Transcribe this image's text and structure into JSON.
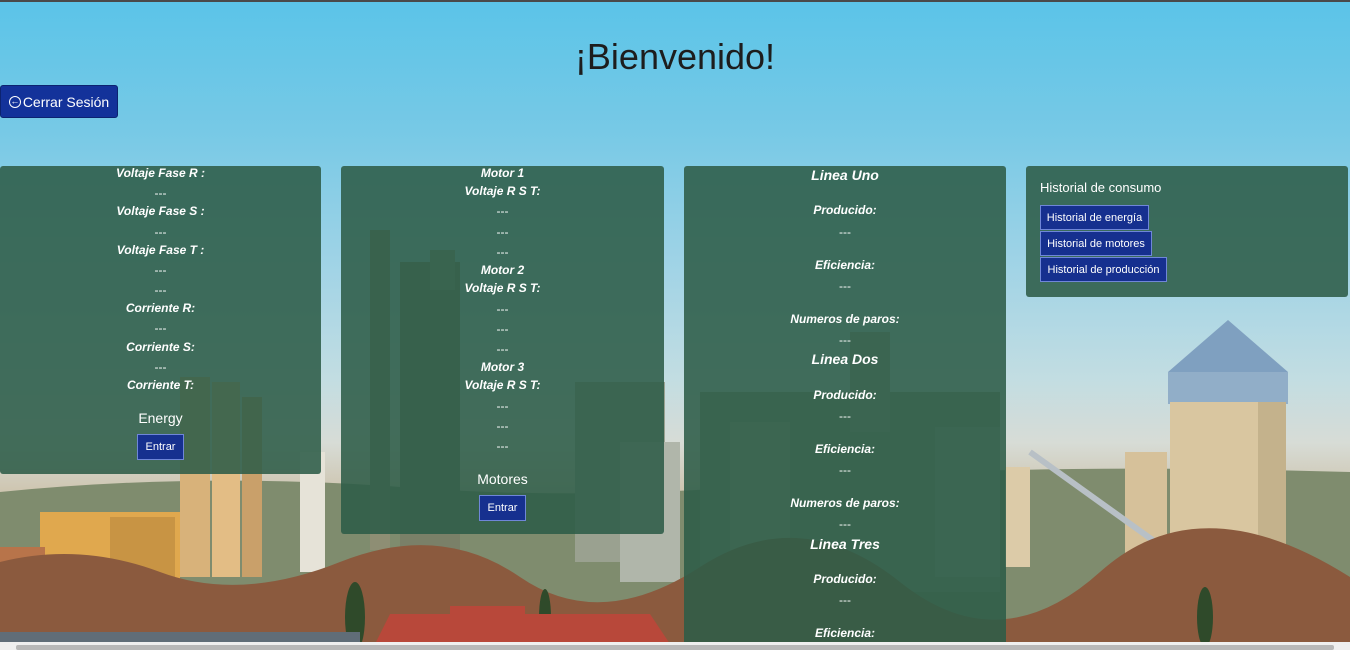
{
  "header": {
    "title": "¡Bienvenido!"
  },
  "logout": {
    "icon": "arrow-left-circle-icon",
    "label": "Cerrar Sesión"
  },
  "energy_panel": {
    "rows": [
      {
        "label": "Voltaje Fase R :",
        "values": [
          "---"
        ]
      },
      {
        "label": "Voltaje Fase S :",
        "values": [
          "---"
        ]
      },
      {
        "label": "Voltaje Fase T :",
        "values": [
          "---",
          "---"
        ]
      },
      {
        "label": "Corriente R:",
        "values": [
          "---"
        ]
      },
      {
        "label": "Corriente S:",
        "values": [
          "---"
        ]
      },
      {
        "label": "Corriente T:",
        "values": []
      }
    ],
    "section_title": "Energy",
    "button_label": "Entrar"
  },
  "motors_panel": {
    "motors": [
      {
        "name": "Motor 1",
        "label": "Voltaje R S T:",
        "values": [
          "---",
          "---",
          "---"
        ]
      },
      {
        "name": "Motor 2",
        "label": "Voltaje R S T:",
        "values": [
          "---",
          "---",
          "---"
        ]
      },
      {
        "name": "Motor 3",
        "label": "Voltaje R S T:",
        "values": [
          "---",
          "---",
          "---"
        ]
      }
    ],
    "section_title": "Motores",
    "button_label": "Entrar"
  },
  "lines_panel": {
    "lines": [
      {
        "name": "Linea Uno",
        "produced_label": "Producido:",
        "produced": "---",
        "efficiency_label": "Eficiencia:",
        "efficiency": "---",
        "stops_label": "Numeros de paros:",
        "stops": "---"
      },
      {
        "name": "Linea Dos",
        "produced_label": "Producido:",
        "produced": "---",
        "efficiency_label": "Eficiencia:",
        "efficiency": "---",
        "stops_label": "Numeros de paros:",
        "stops": "---"
      },
      {
        "name": "Linea Tres",
        "produced_label": "Producido:",
        "produced": "---",
        "efficiency_label": "Eficiencia:",
        "efficiency": ""
      }
    ]
  },
  "history_panel": {
    "title": "Historial de consumo",
    "buttons": [
      "Historial de energía",
      "Historial de motores",
      "Historial de producción"
    ]
  },
  "colors": {
    "panel": "#2d5c48",
    "button": "#16308f",
    "sky": "#5bc4e8"
  }
}
